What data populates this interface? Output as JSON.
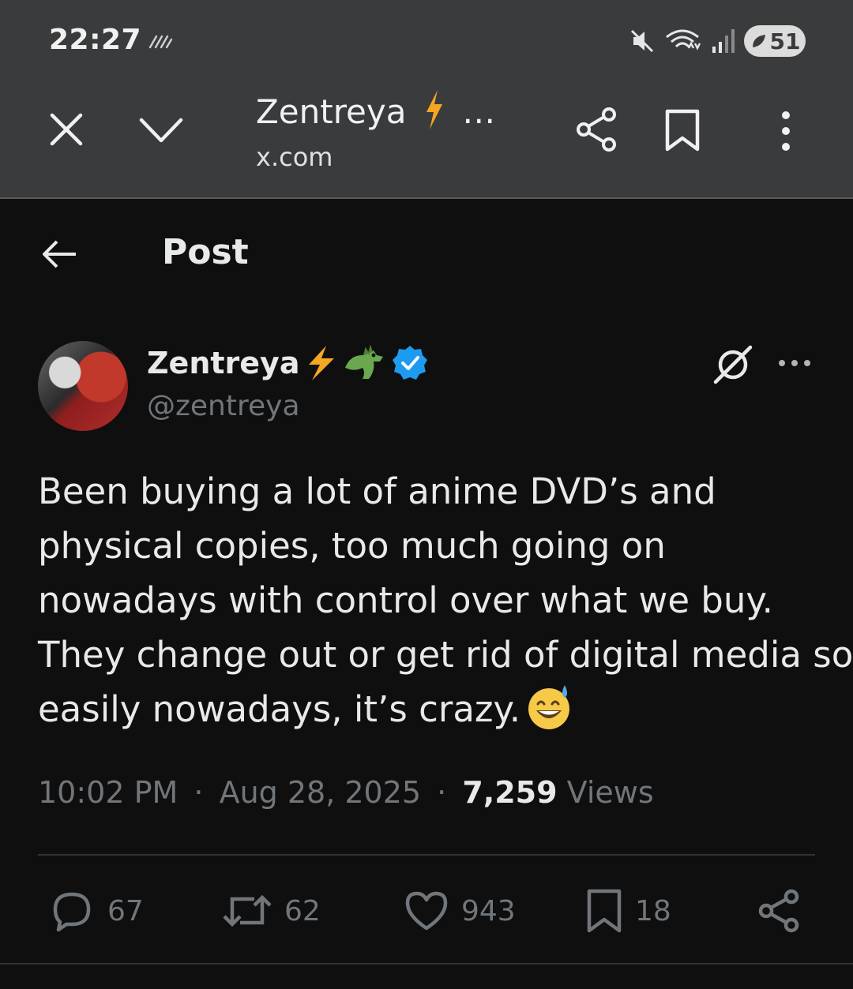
{
  "status_bar": {
    "time": "22:27",
    "battery": "51"
  },
  "browser": {
    "title": "Zentreya",
    "title_suffix": "…",
    "url": "x.com"
  },
  "header": {
    "title": "Post"
  },
  "post": {
    "author_name": "Zentreya",
    "handle": "@zentreya",
    "text_lines": [
      "Been buying a lot of anime DVD’s and",
      "physical copies, too much going on",
      "nowadays with control over what we buy.",
      "They change out or get rid of digital media so",
      "easily nowadays, it’s crazy."
    ],
    "time": "10:02 PM",
    "date": "Aug 28, 2025",
    "views_count": "7,259",
    "views_label": "Views",
    "separator": "·"
  },
  "actions": {
    "replies": "67",
    "reposts": "62",
    "likes": "943",
    "bookmarks": "18"
  },
  "colors": {
    "background": "#0f0f0f",
    "chrome": "#3a3b3d",
    "text_primary": "#e7e9ea",
    "text_secondary": "#71767b",
    "verified": "#1d9bf0",
    "bolt": "#f5a623"
  },
  "icons": [
    "close-icon",
    "chevron-down-icon",
    "share-icon",
    "bookmark-icon",
    "more-vertical-icon",
    "back-arrow-icon",
    "verified-badge-icon",
    "grok-icon",
    "more-horizontal-icon",
    "reply-icon",
    "repost-icon",
    "like-icon",
    "bookmark-icon",
    "share-icon"
  ]
}
